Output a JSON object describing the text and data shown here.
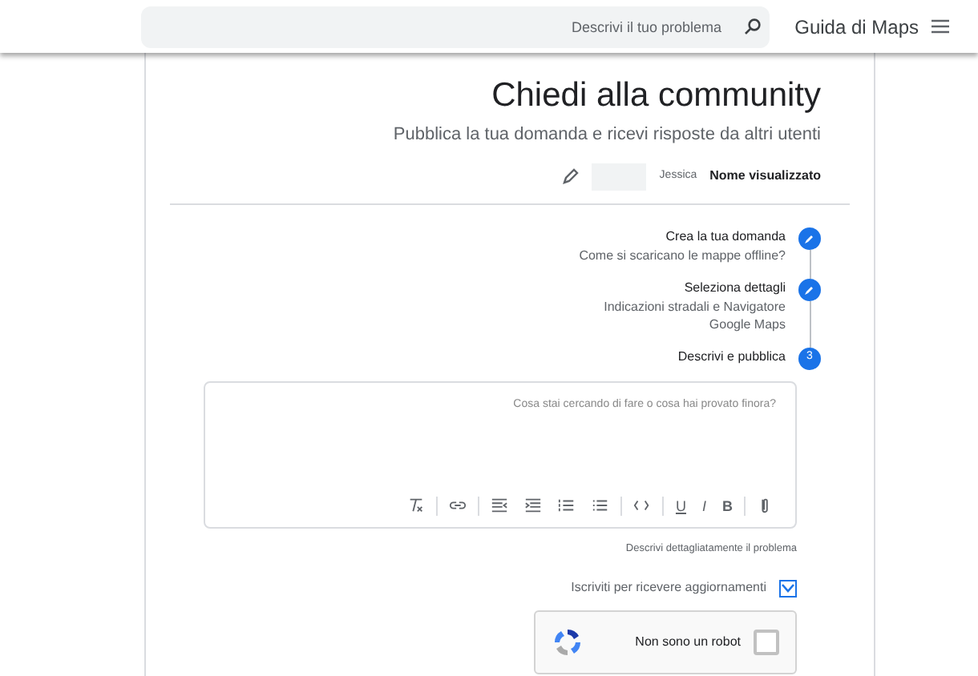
{
  "header": {
    "title": "Guida di Maps",
    "search": {
      "placeholder": "Descrivi il tuo problema"
    }
  },
  "form": {
    "title": "Chiedi alla community",
    "subtitle": "Pubblica la tua domanda e ricevi risposte da altri utenti",
    "display_name": {
      "label": "Nome visualizzato",
      "value": "Jessica"
    },
    "steps": [
      {
        "kind": "done",
        "label": "Crea la tua domanda",
        "details": [
          "Come si scaricano le mappe offline?"
        ]
      },
      {
        "kind": "done",
        "label": "Seleziona dettagli",
        "details": [
          "Indicazioni stradali e Navigatore",
          "Google Maps"
        ]
      },
      {
        "kind": "current",
        "number": "3",
        "label": "Descrivi e pubblica"
      }
    ],
    "editor": {
      "placeholder": "Cosa stai cercando di fare o cosa hai provato finora?",
      "format_buttons": [
        "U",
        "I",
        "B"
      ]
    },
    "hint": "Descrivi dettagliatamente il problema",
    "subscribe": {
      "label": "Iscriviti per ricevere aggiornamenti",
      "checked": true
    },
    "captcha": {
      "label": "Non sono un robot",
      "checked": false
    }
  }
}
